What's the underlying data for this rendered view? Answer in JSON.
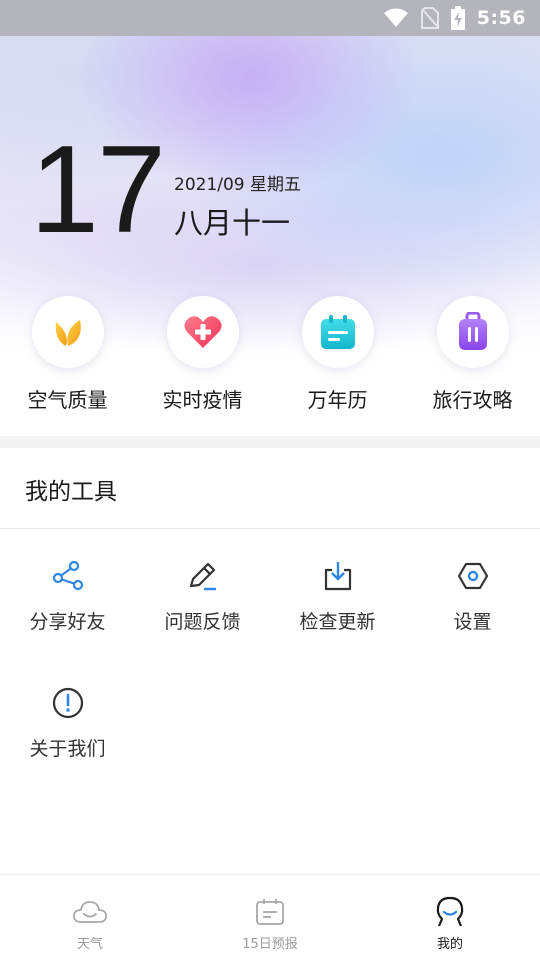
{
  "status_bar": {
    "time": "5:56",
    "icons": [
      "wifi-icon",
      "no-sim-icon",
      "battery-charging-icon"
    ]
  },
  "header": {
    "day": "17",
    "date_line": "2021/09 星期五",
    "lunar_date": "八月十一"
  },
  "quick_actions": [
    {
      "label": "空气质量",
      "icon": "leaf-icon",
      "color": "#f4b21e"
    },
    {
      "label": "实时疫情",
      "icon": "heart-plus-icon",
      "color": "#f0516b"
    },
    {
      "label": "万年历",
      "icon": "calendar-icon",
      "color": "#21c6d8"
    },
    {
      "label": "旅行攻略",
      "icon": "suitcase-icon",
      "color": "#9a5cf0"
    }
  ],
  "tools": {
    "title": "我的工具",
    "items": [
      {
        "label": "分享好友",
        "icon": "share-icon"
      },
      {
        "label": "问题反馈",
        "icon": "edit-icon"
      },
      {
        "label": "检查更新",
        "icon": "download-icon"
      },
      {
        "label": "设置",
        "icon": "settings-hexagon-icon"
      },
      {
        "label": "关于我们",
        "icon": "info-icon"
      }
    ]
  },
  "bottom_nav": {
    "items": [
      {
        "label": "天气",
        "icon": "cloud-icon",
        "active": false
      },
      {
        "label": "15日预报",
        "icon": "forecast-calendar-icon",
        "active": false
      },
      {
        "label": "我的",
        "icon": "profile-icon",
        "active": true
      }
    ]
  },
  "colors": {
    "accent": "#2e86e6",
    "text_primary": "#1a1a1a",
    "nav_inactive": "#9b9b9b",
    "status_bar_bg": "#b4b4bc"
  }
}
